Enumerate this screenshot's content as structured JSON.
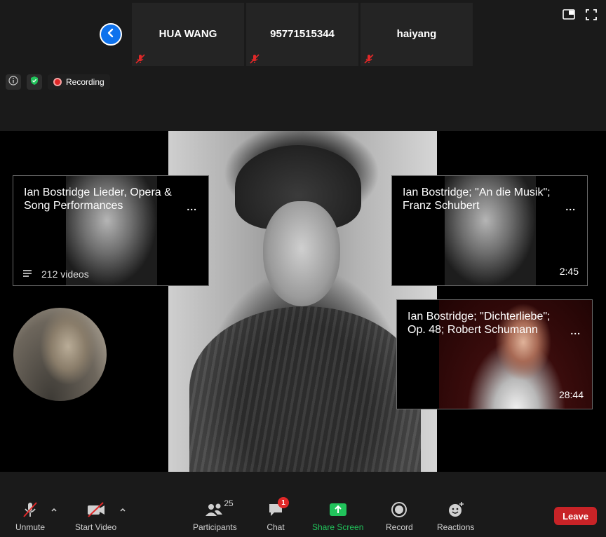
{
  "participants_strip": [
    {
      "name": "HUA WANG"
    },
    {
      "name": "95771515344"
    },
    {
      "name": "haiyang"
    }
  ],
  "status": {
    "recording_label": "Recording"
  },
  "share": {
    "cards": [
      {
        "title": "Ian Bostridge Lieder, Opera & Song Performances",
        "meta": "212 videos"
      },
      {
        "title": "Ian Bostridge; \"An die Musik\"; Franz Schubert",
        "meta": "2:45"
      },
      {
        "title": "Ian Bostridge; \"Dichterliebe\"; Op. 48; Robert Schumann",
        "meta": "28:44"
      }
    ],
    "more_label": "..."
  },
  "toolbar": {
    "unmute_label": "Unmute",
    "start_video_label": "Start Video",
    "participants_label": "Participants",
    "participants_count": "25",
    "chat_label": "Chat",
    "chat_badge": "1",
    "share_screen_label": "Share Screen",
    "record_label": "Record",
    "reactions_label": "Reactions",
    "leave_label": "Leave"
  },
  "colors": {
    "accent_blue": "#0e72ed",
    "share_green": "#21c35b",
    "leave_red": "#c82327",
    "muted_red": "#e02828"
  }
}
